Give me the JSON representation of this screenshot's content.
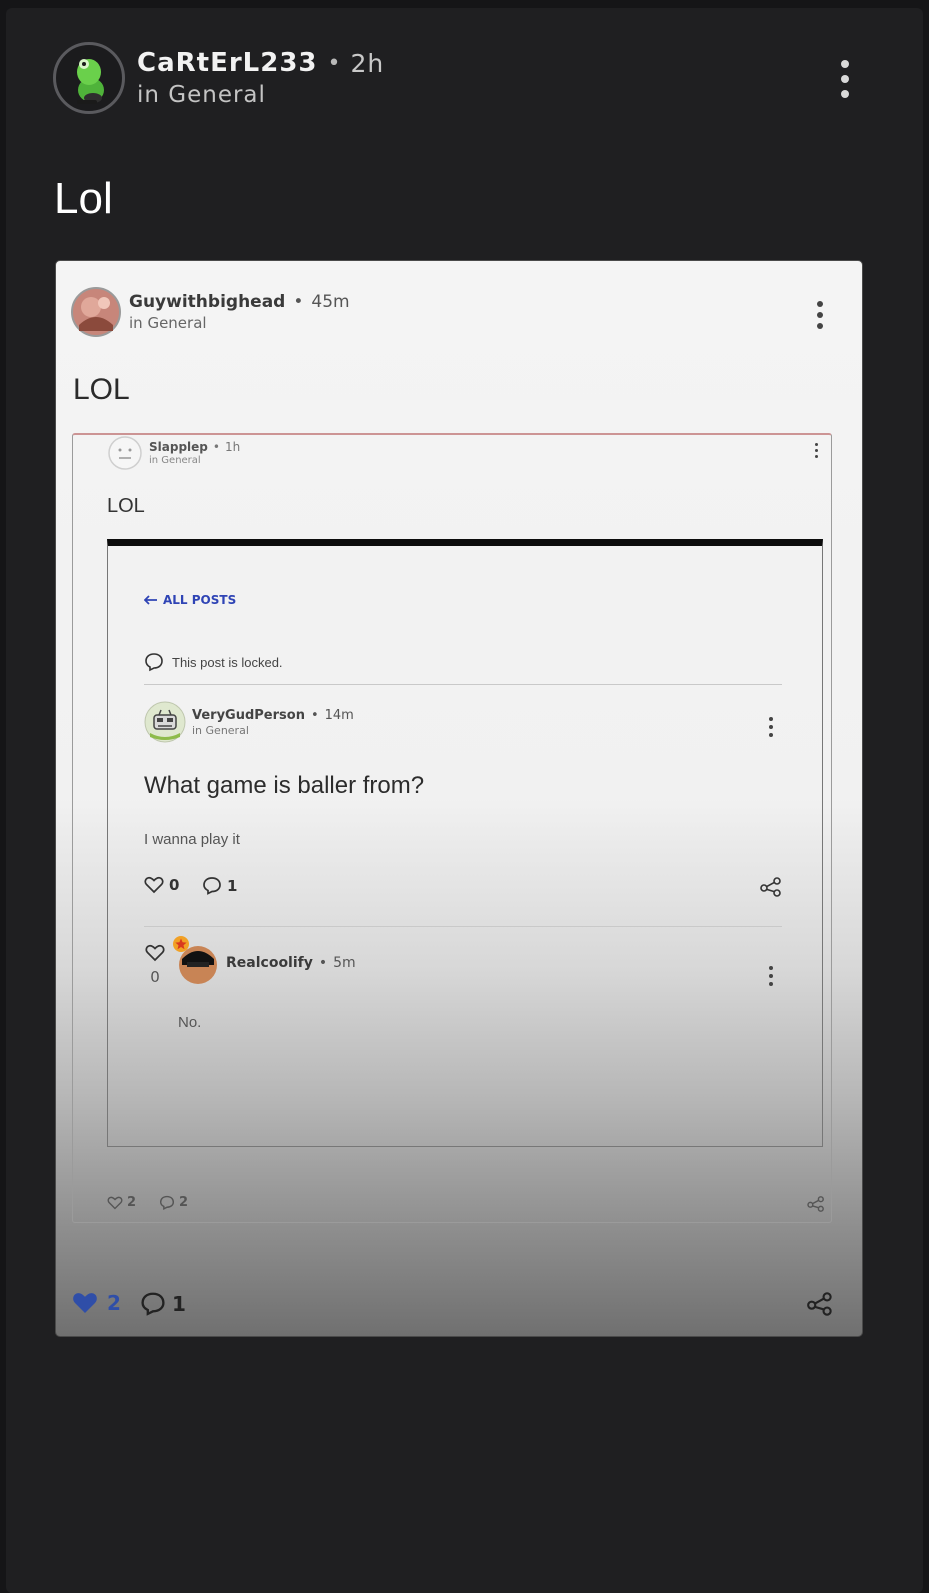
{
  "outer_post": {
    "username": "CaRtErL233",
    "time": "2h",
    "category": "in General",
    "title": "Lol"
  },
  "embedded_post": {
    "username": "Guywithbighead",
    "time": "45m",
    "category": "in General",
    "title": "LOL",
    "likes": "2",
    "comments": "1",
    "like_color": "#2f4ea8"
  },
  "nested_post": {
    "username": "Slapplep",
    "time": "1h",
    "category": "in General",
    "title": "LOL",
    "likes": "2",
    "comments": "2"
  },
  "forum_post": {
    "back_link": "ALL POSTS",
    "locked_notice": "This post is locked.",
    "username": "VeryGudPerson",
    "time": "14m",
    "category": "in General",
    "title": "What game is baller from?",
    "body": "I wanna play it",
    "likes": "0",
    "comments": "1",
    "accent_color": "#2f44b5"
  },
  "reply": {
    "likes": "0",
    "username": "Realcoolify",
    "time": "5m",
    "body": "No."
  },
  "separator": "•"
}
